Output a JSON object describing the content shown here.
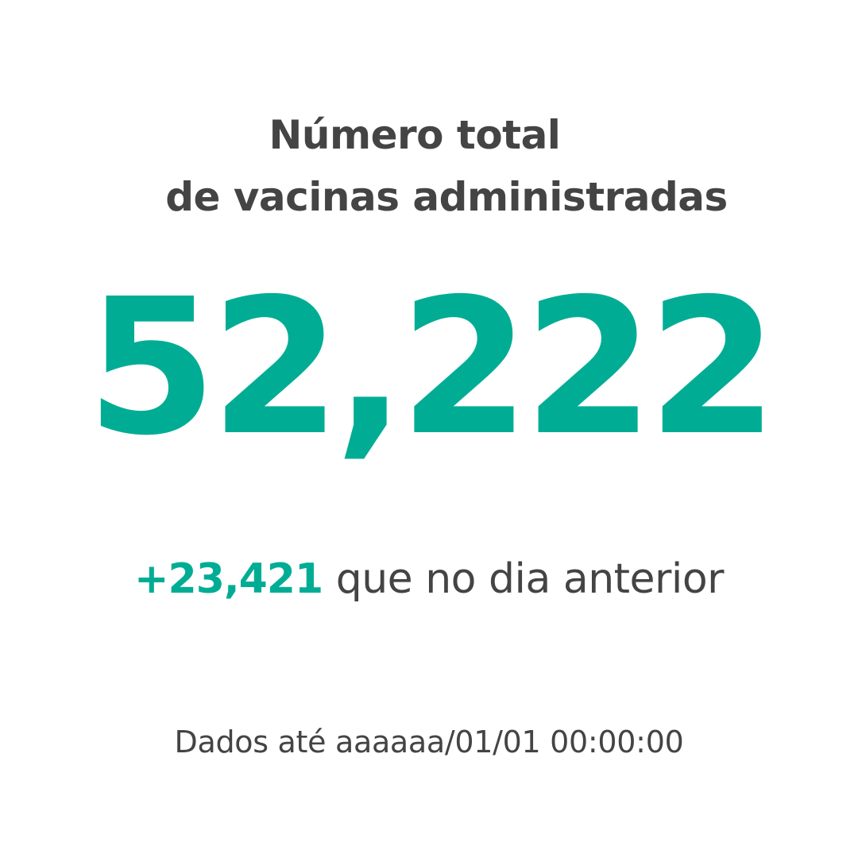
{
  "title": {
    "line1": "Número total",
    "line2": "de vacinas administradas"
  },
  "total_value": "52,222",
  "delta": {
    "value": "+23,421",
    "text": "que no dia anterior"
  },
  "footer": "Dados até aaaaaa/01/01 00:00:00",
  "colors": {
    "accent": "#00ad94",
    "text": "#444444",
    "background": "#ffffff"
  }
}
